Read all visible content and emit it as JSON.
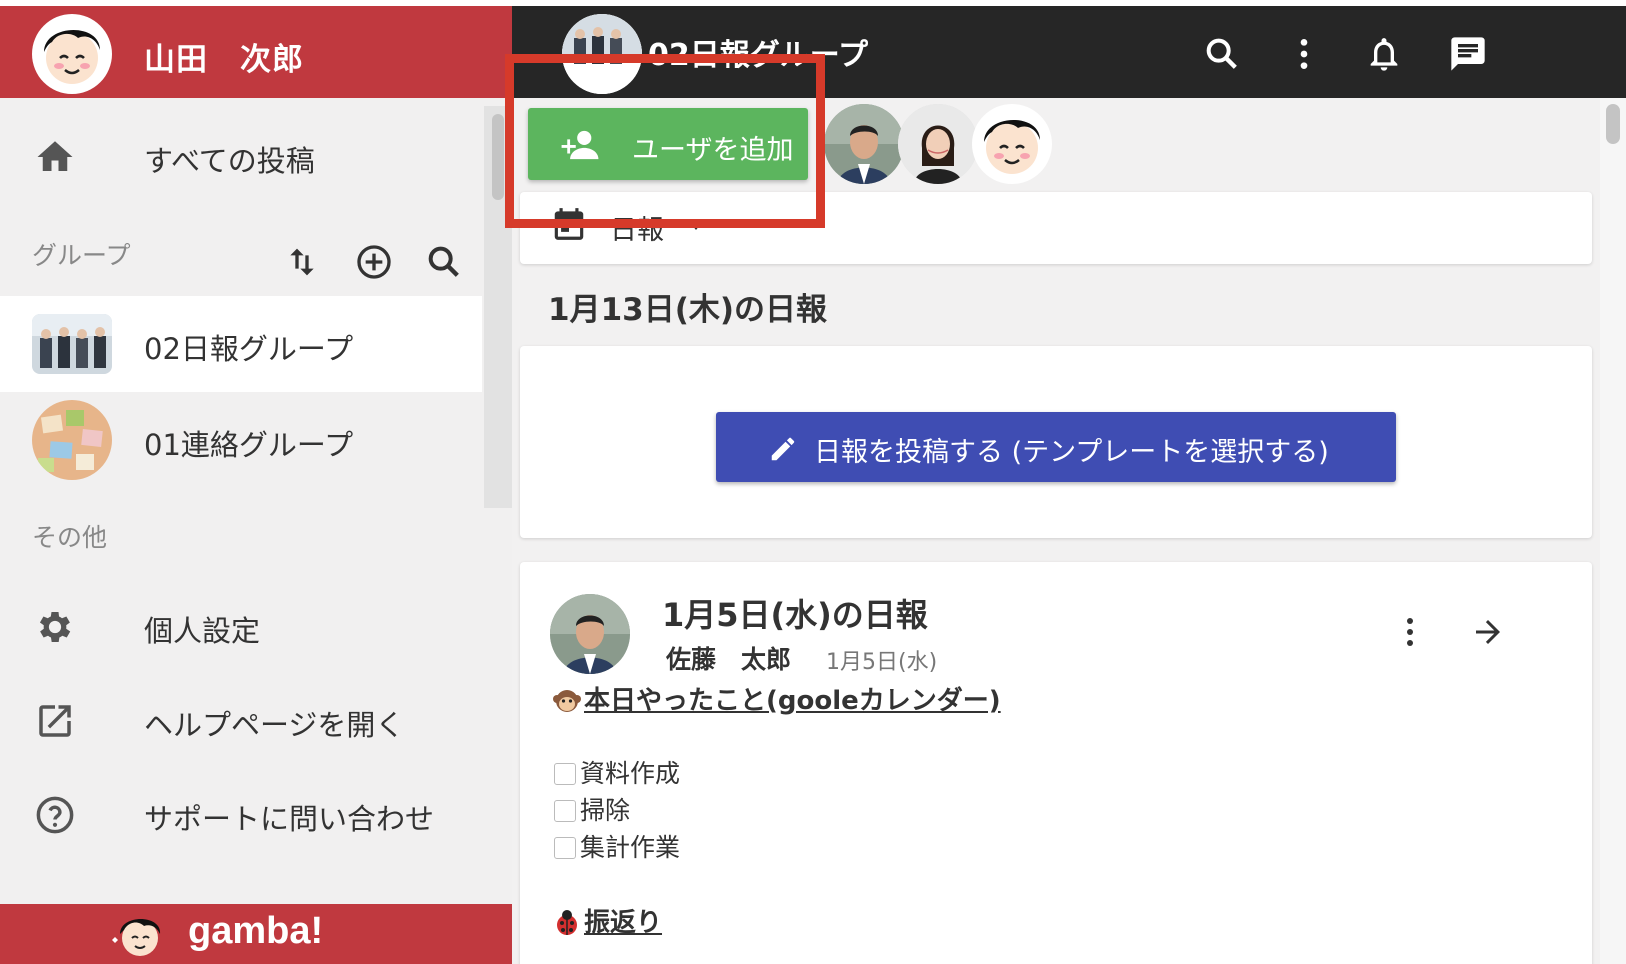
{
  "user": {
    "name": "山田　次郎"
  },
  "sidebar": {
    "all_posts": "すべての投稿",
    "groups_label": "グループ",
    "groups": [
      {
        "name": "02日報グループ",
        "active": true
      },
      {
        "name": "01連絡グループ",
        "active": false
      }
    ],
    "other_label": "その他",
    "other_items": [
      {
        "label": "個人設定",
        "icon": "gear-icon"
      },
      {
        "label": "ヘルプページを開く",
        "icon": "external-link-icon"
      },
      {
        "label": "サポートに問い合わせ",
        "icon": "help-icon"
      }
    ],
    "brand": "gamba!"
  },
  "topbar": {
    "group_title": "02日報グループ"
  },
  "main": {
    "add_user_label": "ユーザを追加",
    "filter_label": "日報",
    "day_heading": "1月13日(木)の日報",
    "compose_label": "日報を投稿する (テンプレートを選択する)",
    "post": {
      "title": "1月5日(水)の日報",
      "author": "佐藤　太郎",
      "date": "1月5日(水)",
      "section1_title": "本日やったこと(gooleカレンダー)",
      "tasks": [
        "資料作成",
        "掃除",
        "集計作業"
      ],
      "section2_title": "振返り"
    }
  },
  "colors": {
    "brand_red": "#c0393f",
    "add_green": "#5cb55e",
    "compose_blue": "#3f4db3",
    "highlight": "#d63a2a"
  }
}
